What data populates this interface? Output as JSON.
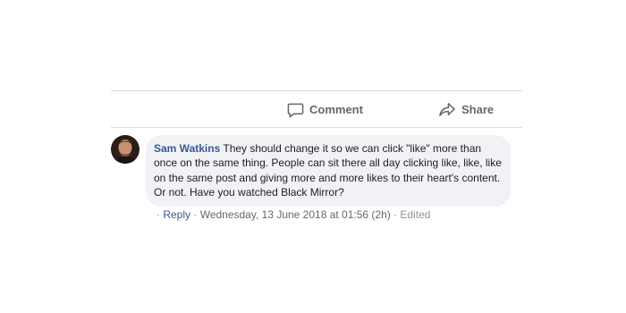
{
  "actions": {
    "comment_label": "Comment",
    "share_label": "Share"
  },
  "comment": {
    "author": "Sam Watkins",
    "text": "They should change it so we can click \"like\" more than once on the same thing. People can sit there all day clicking like, like, like on the same post and giving more and more likes to their heart's content. Or not. Have you watched Black Mirror?",
    "meta": {
      "sep1": "· ",
      "reply_label": "Reply",
      "sep2": " · ",
      "timestamp": "Wednesday, 13 June 2018 at 01:56 (2h)",
      "sep3": " · ",
      "edited_label": "Edited"
    }
  },
  "colors": {
    "link_blue": "#385898",
    "bubble_bg": "#f0f2f5",
    "muted_text": "#606770"
  }
}
